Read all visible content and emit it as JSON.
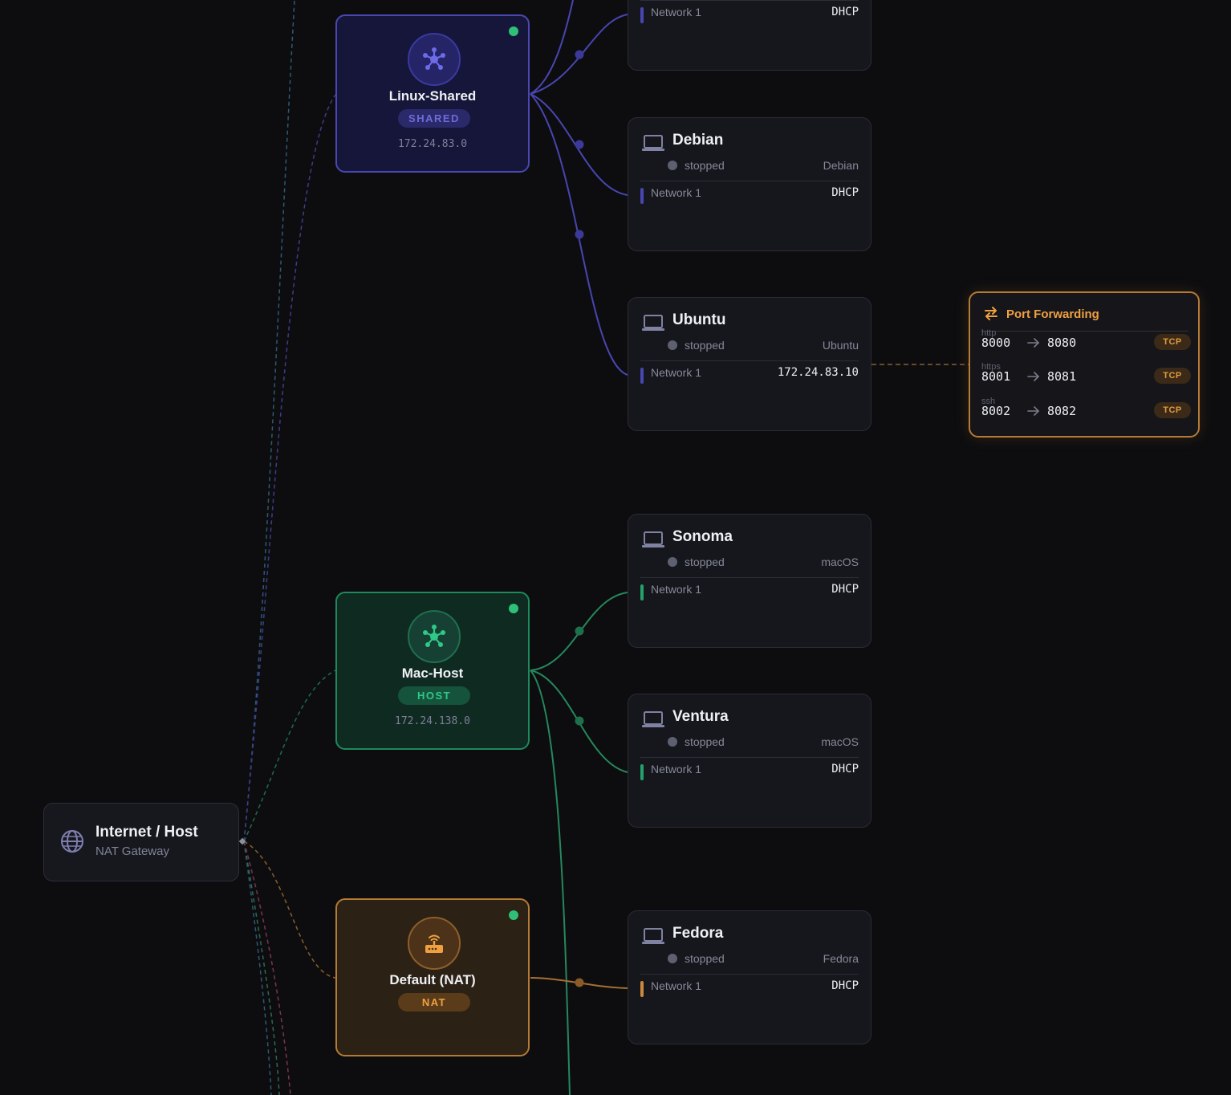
{
  "colors": {
    "shared": "#5b59d0",
    "host": "#25a06c",
    "nat": "#c98a3e",
    "background": "#0d0d10",
    "running_dot": "#2fbf78"
  },
  "internet": {
    "title": "Internet / Host",
    "subtitle": "NAT Gateway",
    "icon": "globe-icon"
  },
  "networks": {
    "shared": {
      "name": "Linux-Shared",
      "type": "SHARED",
      "subnet": "172.24.83.0",
      "icon": "network-hub-icon"
    },
    "host": {
      "name": "Mac-Host",
      "type": "HOST",
      "subnet": "172.24.138.0",
      "icon": "network-hub-icon"
    },
    "nat": {
      "name": "Default (NAT)",
      "type": "NAT",
      "icon": "router-icon"
    }
  },
  "vms": {
    "top": {
      "network": "Network 1",
      "address": "DHCP"
    },
    "debian": {
      "name": "Debian",
      "status": "stopped",
      "os": "Debian",
      "network": "Network 1",
      "address": "DHCP"
    },
    "ubuntu": {
      "name": "Ubuntu",
      "status": "stopped",
      "os": "Ubuntu",
      "network": "Network 1",
      "address": "172.24.83.10"
    },
    "sonoma": {
      "name": "Sonoma",
      "status": "stopped",
      "os": "macOS",
      "network": "Network 1",
      "address": "DHCP"
    },
    "ventura": {
      "name": "Ventura",
      "status": "stopped",
      "os": "macOS",
      "network": "Network 1",
      "address": "DHCP"
    },
    "fedora": {
      "name": "Fedora",
      "status": "stopped",
      "os": "Fedora",
      "network": "Network 1",
      "address": "DHCP"
    }
  },
  "port_forwarding": {
    "title": "Port Forwarding",
    "rules": [
      {
        "service": "http",
        "host_port": "8000",
        "guest_port": "8080",
        "protocol": "TCP"
      },
      {
        "service": "https",
        "host_port": "8001",
        "guest_port": "8081",
        "protocol": "TCP"
      },
      {
        "service": "ssh",
        "host_port": "8002",
        "guest_port": "8082",
        "protocol": "TCP"
      }
    ]
  }
}
